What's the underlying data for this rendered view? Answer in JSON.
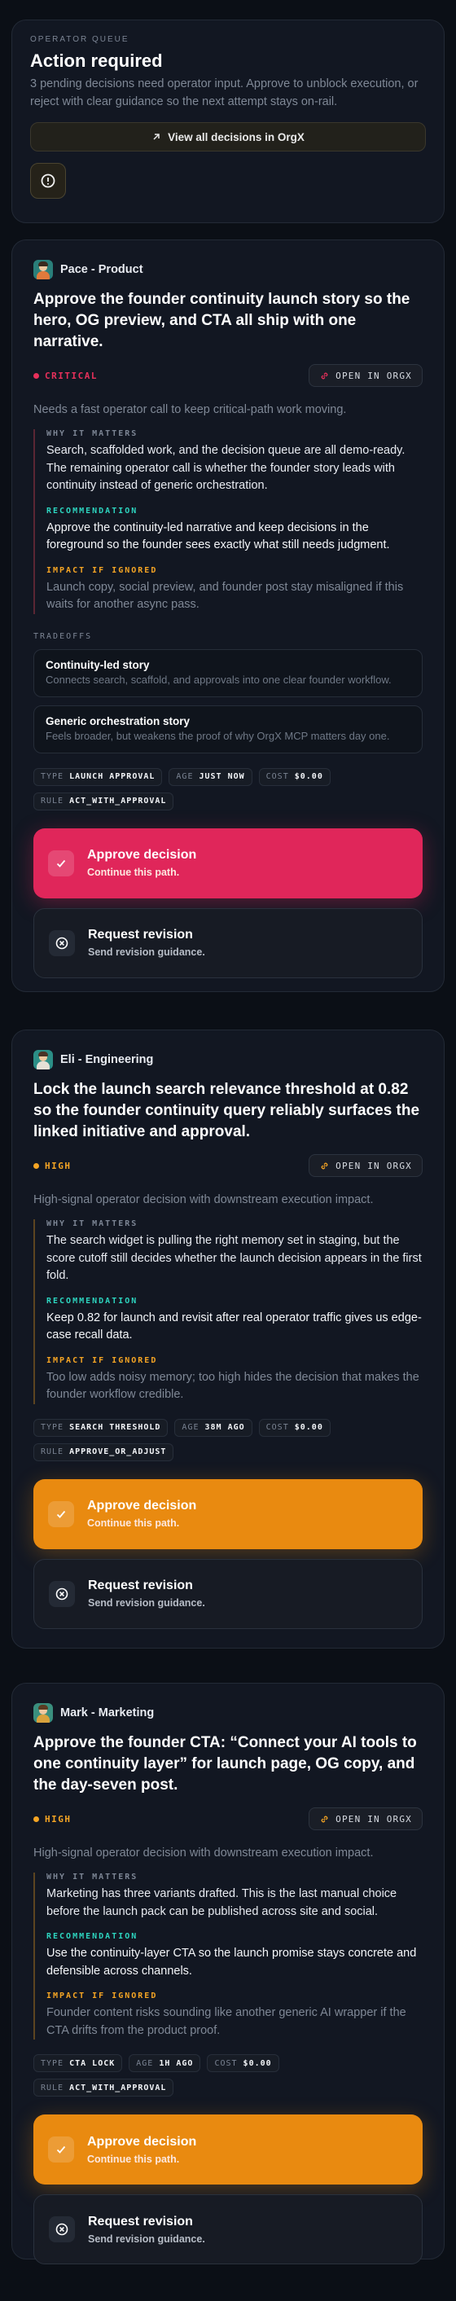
{
  "header": {
    "kicker": "OPERATOR QUEUE",
    "title": "Action required",
    "description": "3 pending decisions need operator input. Approve to unblock execution, or reject with clear guidance so the next attempt stays on-rail.",
    "view_all_label": "View all decisions in OrgX",
    "alert_icon": "alert-circle-icon"
  },
  "colors": {
    "critical": "#e8305b",
    "high": "#f5a524",
    "recommendation": "#2dd4bf",
    "approve_critical": "#e0265a",
    "approve_high": "#e98a10"
  },
  "decisions": [
    {
      "agent": "Pace - Product",
      "title": "Approve the founder continuity launch story so the hero, OG preview, and CTA all ship with one narrative.",
      "priority": "CRITICAL",
      "open_label": "OPEN IN ORGX",
      "summary": "Needs a fast operator call to keep critical-path work moving.",
      "why_label": "WHY IT MATTERS",
      "why": "Search, scaffolded work, and the decision queue are all demo-ready. The remaining operator call is whether the founder story leads with continuity instead of generic orchestration.",
      "rec_label": "RECOMMENDATION",
      "recommendation": "Approve the continuity-led narrative and keep decisions in the foreground so the founder sees exactly what still needs judgment.",
      "impact_label": "IMPACT IF IGNORED",
      "impact": "Launch copy, social preview, and founder post stay misaligned if this waits for another async pass.",
      "tradeoffs_label": "TRADEOFFS",
      "tradeoffs": [
        {
          "title": "Continuity-led story",
          "desc": "Connects search, scaffold, and approvals into one clear founder workflow."
        },
        {
          "title": "Generic orchestration story",
          "desc": "Feels broader, but weakens the proof of why OrgX MCP matters day one."
        }
      ],
      "chips": [
        {
          "k": "TYPE",
          "v": "LAUNCH APPROVAL"
        },
        {
          "k": "AGE",
          "v": "JUST NOW"
        },
        {
          "k": "COST",
          "v": "$0.00"
        },
        {
          "k": "RULE",
          "v": "ACT_WITH_APPROVAL"
        }
      ],
      "approve_label": "Approve decision",
      "approve_sub": "Continue this path.",
      "revise_label": "Request revision",
      "revise_sub": "Send revision guidance."
    },
    {
      "agent": "Eli - Engineering",
      "title": "Lock the launch search relevance threshold at 0.82 so the founder continuity query reliably surfaces the linked initiative and approval.",
      "priority": "HIGH",
      "open_label": "OPEN IN ORGX",
      "summary": "High-signal operator decision with downstream execution impact.",
      "why_label": "WHY IT MATTERS",
      "why": "The search widget is pulling the right memory set in staging, but the score cutoff still decides whether the launch decision appears in the first fold.",
      "rec_label": "RECOMMENDATION",
      "recommendation": "Keep 0.82 for launch and revisit after real operator traffic gives us edge-case recall data.",
      "impact_label": "IMPACT IF IGNORED",
      "impact": "Too low adds noisy memory; too high hides the decision that makes the founder workflow credible.",
      "chips": [
        {
          "k": "TYPE",
          "v": "SEARCH THRESHOLD"
        },
        {
          "k": "AGE",
          "v": "38M AGO"
        },
        {
          "k": "COST",
          "v": "$0.00"
        },
        {
          "k": "RULE",
          "v": "APPROVE_OR_ADJUST"
        }
      ],
      "approve_label": "Approve decision",
      "approve_sub": "Continue this path.",
      "revise_label": "Request revision",
      "revise_sub": "Send revision guidance."
    },
    {
      "agent": "Mark - Marketing",
      "title": "Approve the founder CTA: “Connect your AI tools to one continuity layer” for launch page, OG copy, and the day-seven post.",
      "priority": "HIGH",
      "open_label": "OPEN IN ORGX",
      "summary": "High-signal operator decision with downstream execution impact.",
      "why_label": "WHY IT MATTERS",
      "why": "Marketing has three variants drafted. This is the last manual choice before the launch pack can be published across site and social.",
      "rec_label": "RECOMMENDATION",
      "recommendation": "Use the continuity-layer CTA so the launch promise stays concrete and defensible across channels.",
      "impact_label": "IMPACT IF IGNORED",
      "impact": "Founder content risks sounding like another generic AI wrapper if the CTA drifts from the product proof.",
      "chips": [
        {
          "k": "TYPE",
          "v": "CTA LOCK"
        },
        {
          "k": "AGE",
          "v": "1H AGO"
        },
        {
          "k": "COST",
          "v": "$0.00"
        },
        {
          "k": "RULE",
          "v": "ACT_WITH_APPROVAL"
        }
      ],
      "approve_label": "Approve decision",
      "approve_sub": "Continue this path.",
      "revise_label": "Request revision",
      "revise_sub": "Send revision guidance."
    }
  ]
}
